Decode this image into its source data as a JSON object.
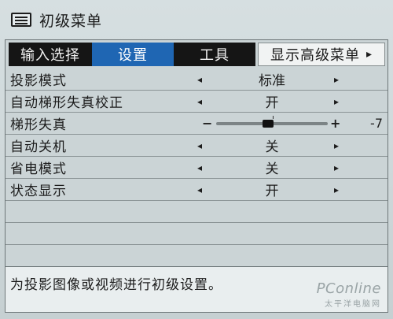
{
  "window": {
    "title": "初级菜单",
    "icon": "menu-list-icon"
  },
  "tabs": [
    {
      "label": "输入选择"
    },
    {
      "label": "设置"
    },
    {
      "label": "工具"
    },
    {
      "label": "显示高级菜单",
      "arrow": "▸"
    }
  ],
  "settings": [
    {
      "label": "投影模式",
      "value": "标准"
    },
    {
      "label": "自动梯形失真校正",
      "value": "开"
    },
    {
      "label": "梯形失真",
      "slider_min_symbol": "−",
      "slider_plus_symbol": "+",
      "value": "-7",
      "slider_position_fraction": 0.46
    },
    {
      "label": "自动关机",
      "value": "关"
    },
    {
      "label": "省电模式",
      "value": "关"
    },
    {
      "label": "状态显示",
      "value": "开"
    }
  ],
  "arrows": {
    "left": "◂",
    "right": "▸"
  },
  "status": {
    "text": "为投影图像或视频进行初级设置。"
  },
  "watermark": {
    "brand": "PConline",
    "sub": "太平洋电脑网"
  },
  "colors": {
    "tab_selected": "#1f66b3",
    "tab_dark": "#151515"
  }
}
